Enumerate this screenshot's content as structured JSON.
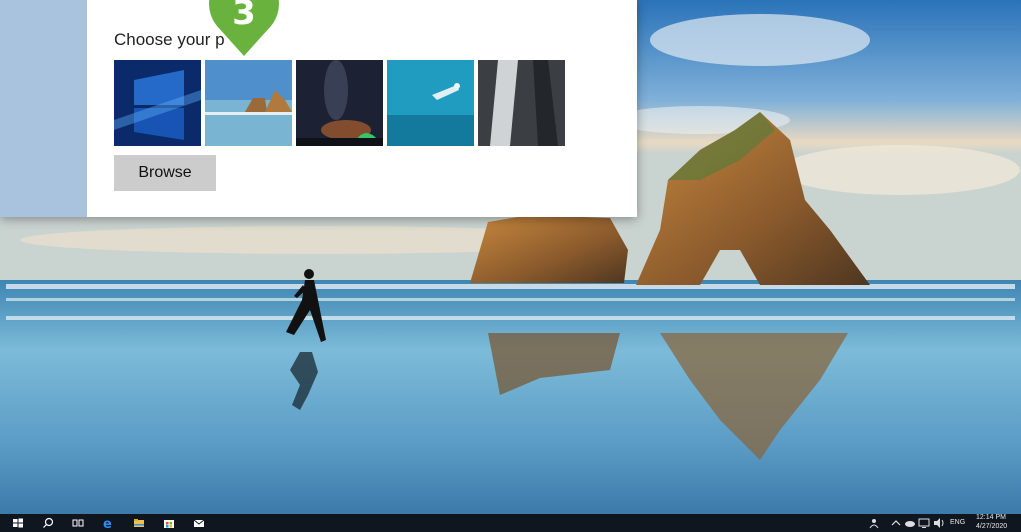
{
  "window": {
    "heading": "Choose your p",
    "browse_label": "Browse",
    "thumbnails": [
      {
        "name": "windows-hero-wallpaper"
      },
      {
        "name": "beach-rock-wallpaper"
      },
      {
        "name": "night-sky-wallpaper"
      },
      {
        "name": "underwater-swimmer-wallpaper"
      },
      {
        "name": "waterfall-wallpaper"
      }
    ]
  },
  "step_marker": {
    "number": "3",
    "color": "#6ab23e"
  },
  "taskbar": {
    "language": "ENG",
    "time": "12:14 PM",
    "date": "4/27/2020",
    "icons": [
      "windows-start-icon",
      "search-icon",
      "task-view-icon",
      "edge-browser-icon",
      "file-explorer-icon",
      "store-icon",
      "mail-icon"
    ]
  },
  "colors": {
    "sidebar": "#a9c3df",
    "taskbar": "#101620",
    "browse_button": "#cccccc",
    "accent": "#6ab23e"
  }
}
